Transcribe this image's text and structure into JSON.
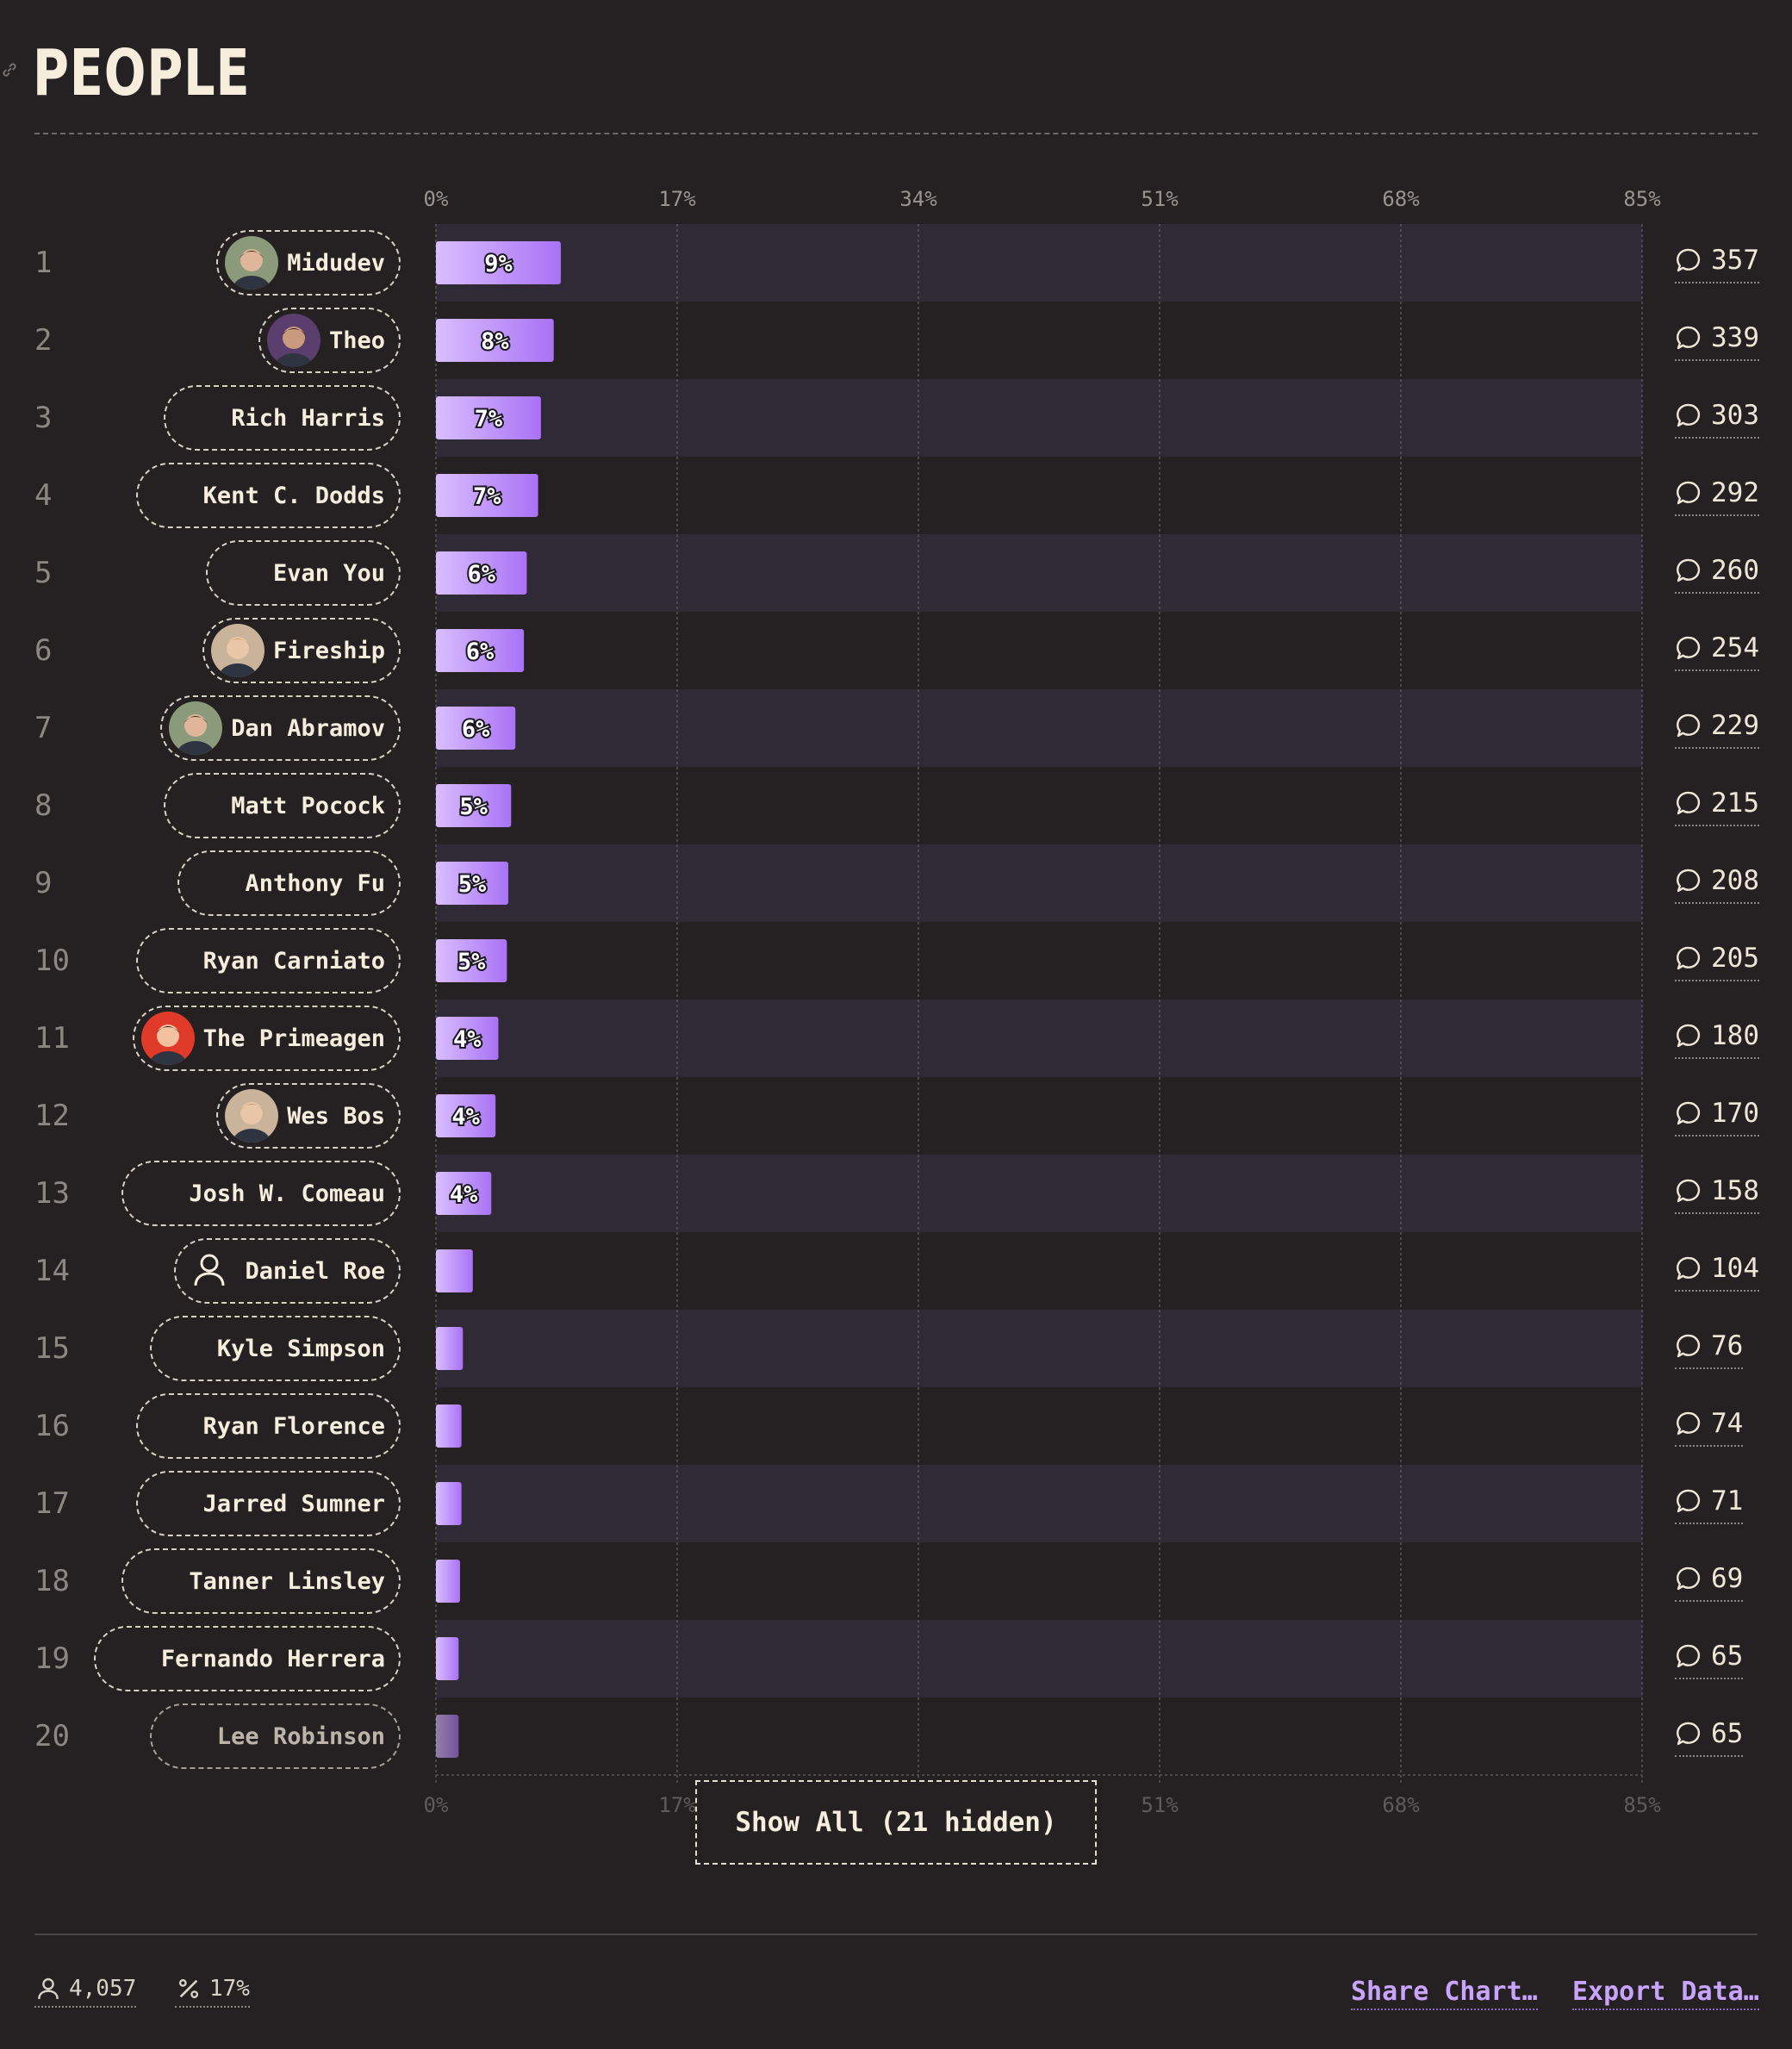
{
  "section": {
    "title": "PEOPLE",
    "link_icon": "link-icon"
  },
  "colors": {
    "background": "#252122",
    "row_stripe": "#302a36",
    "bar_start": "#d9beff",
    "bar_end": "#a972f5",
    "accent": "#c9a4ff"
  },
  "chart_data": {
    "type": "bar",
    "orientation": "horizontal",
    "xlim": [
      0,
      85
    ],
    "x_ticks": [
      "0%",
      "17%",
      "34%",
      "51%",
      "68%",
      "85%"
    ],
    "categories": [
      "Midudev",
      "Theo",
      "Rich Harris",
      "Kent C. Dodds",
      "Evan You",
      "Fireship",
      "Dan Abramov",
      "Matt Pocock",
      "Anthony Fu",
      "Ryan Carniato",
      "The Primeagen",
      "Wes Bos",
      "Josh W. Comeau",
      "Daniel Roe",
      "Kyle Simpson",
      "Ryan Florence",
      "Jarred Sumner",
      "Tanner Linsley",
      "Fernando Herrera",
      "Lee Robinson"
    ],
    "ranks": [
      "1",
      "2",
      "3",
      "4",
      "5",
      "6",
      "7",
      "8",
      "9",
      "10",
      "11",
      "12",
      "13",
      "14",
      "15",
      "16",
      "17",
      "18",
      "19",
      "20"
    ],
    "values": [
      8.8,
      8.3,
      7.4,
      7.2,
      6.4,
      6.2,
      5.6,
      5.3,
      5.1,
      5.0,
      4.4,
      4.2,
      3.9,
      2.6,
      1.9,
      1.8,
      1.8,
      1.7,
      1.6,
      1.6
    ],
    "value_labels": [
      "9%",
      "8%",
      "7%",
      "7%",
      "6%",
      "6%",
      "6%",
      "5%",
      "5%",
      "5%",
      "4%",
      "4%",
      "4%",
      "",
      "",
      "",
      "",
      "",
      "",
      ""
    ],
    "comments": [
      "357",
      "339",
      "303",
      "292",
      "260",
      "254",
      "229",
      "215",
      "208",
      "205",
      "180",
      "170",
      "158",
      "104",
      "76",
      "74",
      "71",
      "69",
      "65",
      "65"
    ],
    "avatars": [
      "photo",
      "photo",
      "",
      "",
      "",
      "photo",
      "photo",
      "",
      "",
      "",
      "photo",
      "photo",
      "",
      "user-icon",
      "",
      "",
      "",
      "",
      "",
      ""
    ],
    "legend": "none"
  },
  "show_all_label": "Show All (21 hidden)",
  "footer": {
    "respondents": "4,057",
    "percent": "17%",
    "share_label": "Share Chart…",
    "export_label": "Export Data…"
  }
}
